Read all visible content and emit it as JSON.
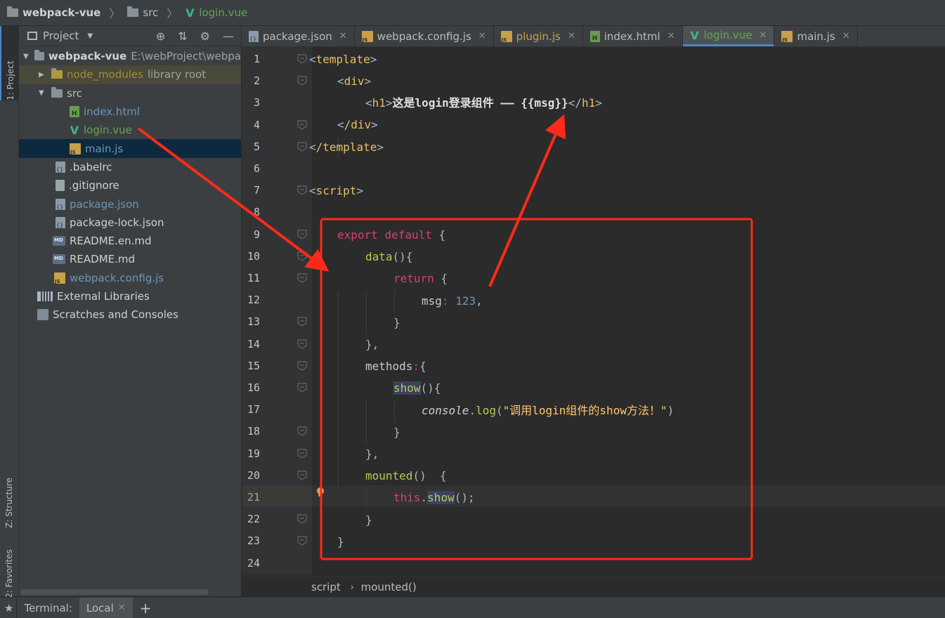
{
  "navbar": {
    "project": "webpack-vue",
    "folder": "src",
    "file": "login.vue"
  },
  "toolstrip": {
    "project": "1: Project",
    "structure": "Z: Structure",
    "favorites": "2: Favorites"
  },
  "project_panel": {
    "title": "Project",
    "root": {
      "name": "webpack-vue",
      "path": "E:\\webProject\\webpa"
    },
    "node_modules": {
      "name": "node_modules",
      "note": "library root"
    },
    "src": "src",
    "files_src": [
      "index.html",
      "login.vue",
      "main.js"
    ],
    "files_root": [
      ".babelrc",
      ".gitignore",
      "package.json",
      "package-lock.json",
      "README.en.md",
      "README.md",
      "webpack.config.js"
    ],
    "external": "External Libraries",
    "scratches": "Scratches and Consoles"
  },
  "tabs": [
    {
      "label": "package.json",
      "icon": "json-icon"
    },
    {
      "label": "webpack.config.js",
      "icon": "js-icon"
    },
    {
      "label": "plugin.js",
      "icon": "js-icon"
    },
    {
      "label": "index.html",
      "icon": "html-icon"
    },
    {
      "label": "login.vue",
      "icon": "vue-icon",
      "active": true
    },
    {
      "label": "main.js",
      "icon": "js-icon"
    }
  ],
  "code": {
    "line_numbers": [
      "1",
      "2",
      "3",
      "4",
      "5",
      "6",
      "7",
      "8",
      "9",
      "10",
      "11",
      "12",
      "13",
      "14",
      "15",
      "16",
      "17",
      "18",
      "19",
      "20",
      "21",
      "22",
      "23",
      "24"
    ],
    "current_line": "21",
    "l1_tag": "template",
    "l2_tag": "div",
    "l3_tag": "h1",
    "l3_text": "这是login登录组件 —— {{msg}}",
    "l4_tag": "/div",
    "l5_tag": "/template",
    "l7_tag": "script",
    "l9_export": "export",
    "l9_default": "default",
    "l10_fn": "data",
    "l11_return": "return",
    "l12_key": "msg",
    "l12_value": "123",
    "l15_methods": "methods",
    "l16_fn": "show",
    "l17_console": "console",
    "l17_log": "log",
    "l17_string": "\"调用login组件的show方法！\"",
    "l20_fn": "mounted",
    "l21_this": "this",
    "l21_call": "show"
  },
  "editor_breadcrumb": {
    "part1": "script",
    "part2": "mounted()"
  },
  "bottombar": {
    "terminal": "Terminal:",
    "local": "Local"
  },
  "colors": {
    "annotation": "#ff2a1a",
    "accent": "#4a88c7"
  }
}
